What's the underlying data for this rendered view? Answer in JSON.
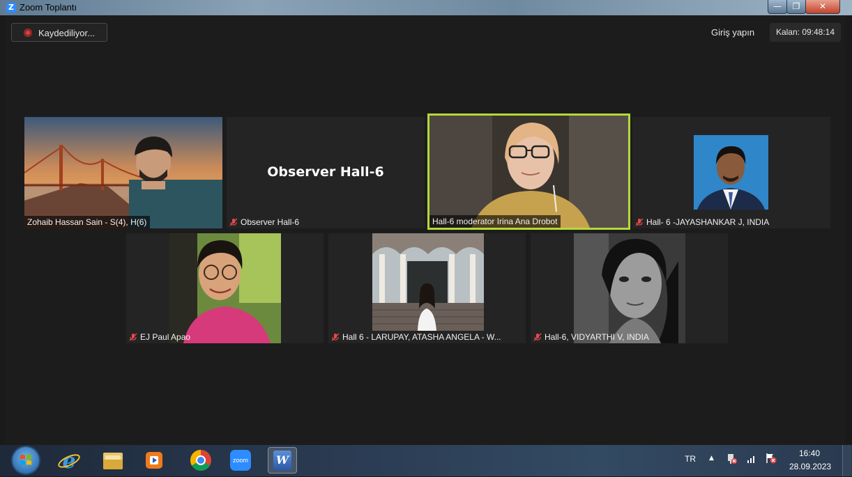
{
  "window": {
    "title": "Zoom Toplantı",
    "logo_letter": "Z",
    "min_glyph": "—",
    "max_glyph": "❐",
    "close_glyph": "✕"
  },
  "toolbar": {
    "recording_label": "Kaydediliyor...",
    "signin_label": "Giriş yapın",
    "time_remaining": "Kalan: 09:48:14"
  },
  "participants": [
    {
      "name": "Zohaib Hassan Sain - S(4), H(6)",
      "muted": false,
      "video": true
    },
    {
      "name": "Observer Hall-6",
      "muted": true,
      "video": false,
      "display_name": "Observer Hall-6"
    },
    {
      "name": "Hall-6 moderator Irina Ana Drobot",
      "muted": false,
      "video": true,
      "active_speaker": true
    },
    {
      "name": "Hall- 6 -JAYASHANKAR J, INDIA",
      "muted": true,
      "video": true
    },
    {
      "name": "EJ Paul Apao",
      "muted": true,
      "video": true
    },
    {
      "name": "Hall 6 - LARUPAY, ATASHA ANGELA - W...",
      "muted": true,
      "video": true
    },
    {
      "name": "Hall-6, VIDYARTHI V, INDIA",
      "muted": true,
      "video": true
    }
  ],
  "taskbar": {
    "apps": [
      "start-orb",
      "internet-explorer",
      "file-explorer",
      "media-player",
      "chrome",
      "zoom",
      "word"
    ],
    "zoom_label": "zoom",
    "word_label": "W",
    "language": "TR",
    "tray_arrow": "▲",
    "clock_time": "16:40",
    "clock_date": "28.09.2023"
  },
  "colors": {
    "active_speaker_border": "#b4d93a",
    "recording_dot": "#e04040",
    "zoom_blue": "#2d8cff",
    "mute_red": "#e5484d"
  }
}
